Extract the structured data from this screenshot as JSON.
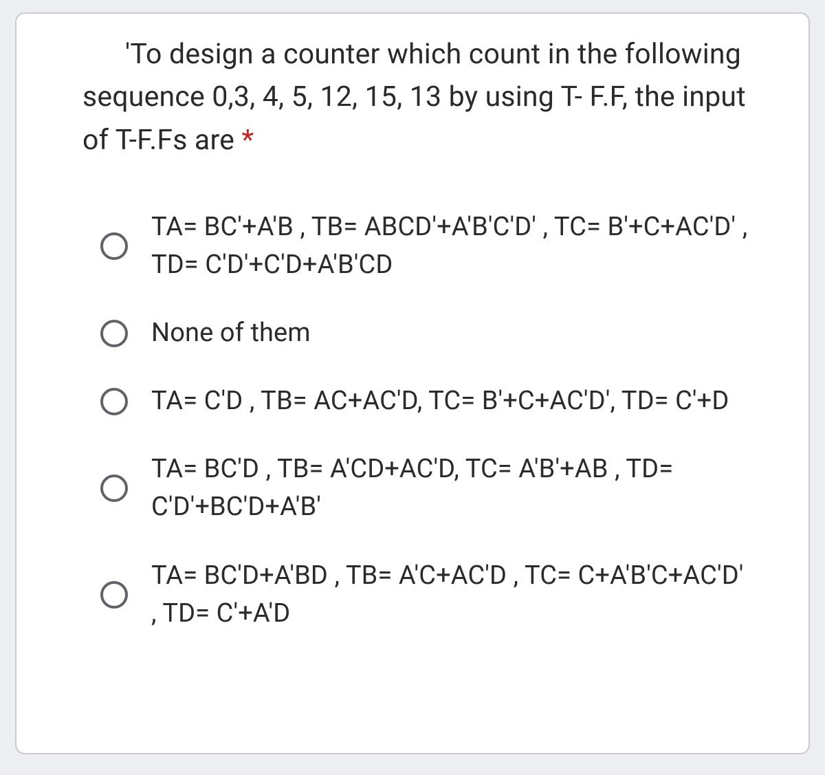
{
  "question": {
    "text": "'To design a counter which count in the following sequence 0,3, 4, 5, 12, 15, 13 by using T- F.F, the input of T-F.Fs are ",
    "required_marker": "*"
  },
  "options": [
    {
      "label": "TA= BC'+A'B , TB= ABCD'+A'B'C'D' , TC= B'+C+AC'D' , TD= C'D'+C'D+A'B'CD"
    },
    {
      "label": "None of them"
    },
    {
      "label": "TA= C'D , TB= AC+AC'D, TC= B'+C+AC'D', TD= C'+D"
    },
    {
      "label": "TA= BC'D , TB= A'CD+AC'D, TC= A'B'+AB , TD= C'D'+BC'D+A'B'"
    },
    {
      "label": "TA= BC'D+A'BD , TB= A'C+AC'D , TC= C+A'B'C+AC'D' , TD= C'+A'D"
    }
  ]
}
